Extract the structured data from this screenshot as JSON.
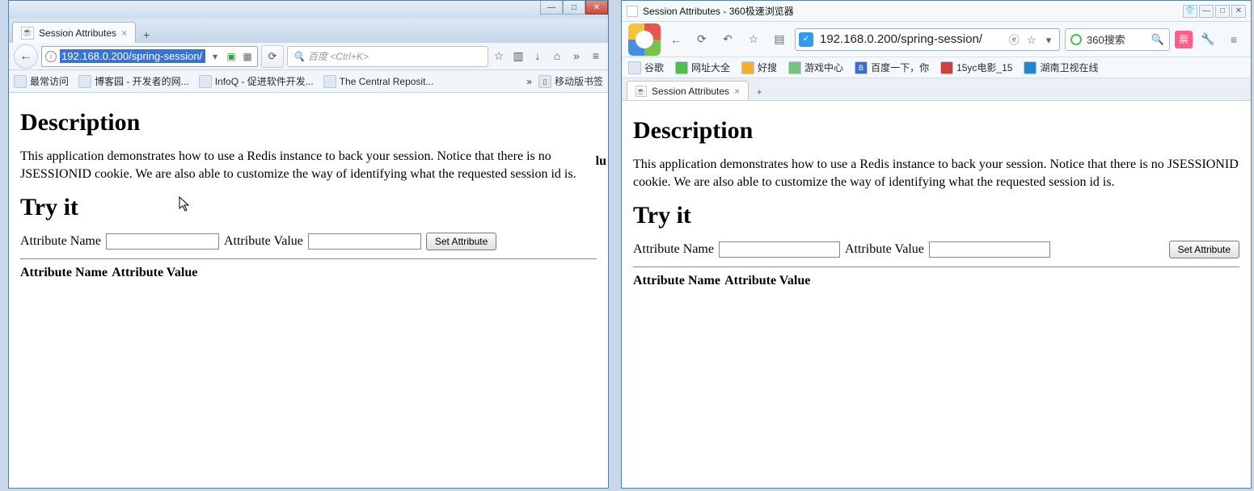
{
  "firefox": {
    "tab_title": "Session Attributes",
    "url": "192.168.0.200/spring-session/",
    "search_placeholder": "百度 <Ctrl+K>",
    "bookmarks": [
      "最常访问",
      "博客园 - 开发者的网...",
      "InfoQ - 促进软件开发...",
      "The Central Reposit..."
    ],
    "bookmarks_right": "移动版书签",
    "window_buttons": {
      "min": "—",
      "max": "□",
      "close": "✕"
    },
    "truncation_hint": "lu"
  },
  "b360": {
    "window_title": "Session Attributes - 360极速浏览器",
    "tab_title": "Session Attributes",
    "url": "192.168.0.200/spring-session/",
    "search_label": "360搜索",
    "badge": "票",
    "bookmarks": [
      "谷歌",
      "网址大全",
      "好搜",
      "游戏中心",
      "百度一下，你",
      "15yc电影_15",
      "湖南卫视在线"
    ]
  },
  "page": {
    "h_description": "Description",
    "desc_text": "This application demonstrates how to use a Redis instance to back your session. Notice that there is no JSESSIONID cookie. We are also able to customize the way of identifying what the requested session id is.",
    "h_try": "Try it",
    "attr_name_label": "Attribute Name",
    "attr_value_label": "Attribute Value",
    "set_button": "Set Attribute",
    "col_name": "Attribute Name",
    "col_value": "Attribute Value"
  }
}
